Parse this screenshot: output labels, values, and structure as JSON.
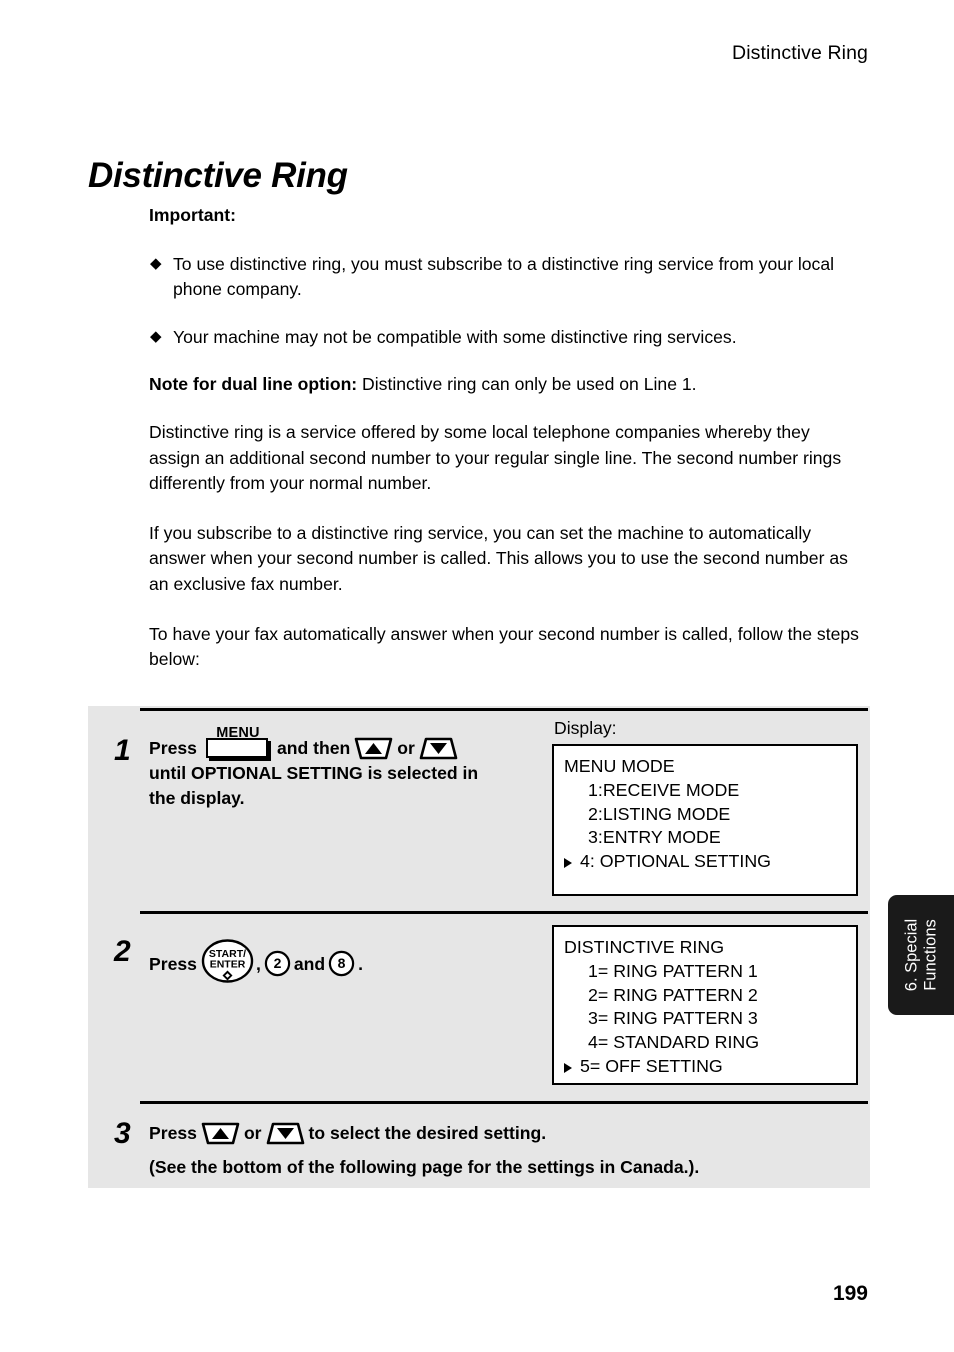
{
  "running_head": "Distinctive Ring",
  "page_title": "Distinctive Ring",
  "folio": "199",
  "prose": {
    "important_label": "Important:",
    "bullets": [
      "To use distinctive ring, you must subscribe to a distinctive ring service from your local phone company.",
      "Your machine may not be compatible with some distinctive ring services."
    ],
    "note_label": "Note for dual line option:",
    "note_text": " Distinctive ring can only be used on Line 1.",
    "paragraphs": [
      "Distinctive ring is a service offered by some local telephone companies whereby they assign an additional second number to your regular single line. The second number rings differently from your normal number.",
      "If you subscribe to a distinctive ring service, you can set the machine to automatically answer when your second number is called. This allows you to use the second number as an exclusive fax number.",
      "To have your fax automatically answer when your second number is called, follow the steps below:"
    ]
  },
  "steps": {
    "display_label": "Display:",
    "step1": {
      "number": "1",
      "text_press": "Press",
      "text_and_then": "and then",
      "text_or": "or",
      "line2": "until OPTIONAL SETTING is selected in",
      "line3": "the display.",
      "key_menu_caption": "MENU",
      "display_lines": [
        {
          "text": "MENU MODE",
          "indent": false,
          "cursor": false
        },
        {
          "text": "1:RECEIVE MODE",
          "indent": true,
          "cursor": false
        },
        {
          "text": "2:LISTING MODE",
          "indent": true,
          "cursor": false
        },
        {
          "text": "3:ENTRY MODE",
          "indent": true,
          "cursor": false
        },
        {
          "text": "4: OPTIONAL SETTING",
          "indent": false,
          "cursor": true
        }
      ]
    },
    "step2": {
      "number": "2",
      "text_press": "Press",
      "text_comma": ",",
      "text_and": "and",
      "text_period": ".",
      "key_start_line1": "START/",
      "key_start_line2": "ENTER",
      "key_num_first": "2",
      "key_num_second": "8",
      "display_lines": [
        {
          "text": "DISTINCTIVE RING",
          "indent": false,
          "cursor": false
        },
        {
          "text": "1= RING PATTERN 1",
          "indent": true,
          "cursor": false
        },
        {
          "text": "2= RING PATTERN 2",
          "indent": true,
          "cursor": false
        },
        {
          "text": "3= RING PATTERN 3",
          "indent": true,
          "cursor": false
        },
        {
          "text": "4= STANDARD RING",
          "indent": true,
          "cursor": false
        },
        {
          "text": "5= OFF SETTING",
          "indent": false,
          "cursor": true
        }
      ]
    },
    "step3": {
      "number": "3",
      "text_press": "Press",
      "text_or": "or",
      "text_tail": "to select the desired setting.",
      "line2": "(See the bottom of the following page for the settings in Canada.)."
    }
  },
  "thumb_tab": {
    "line1": "6. Special",
    "line2": "Functions"
  },
  "colors": {
    "panel_background": "#e6e6e6",
    "rule": "#000000",
    "tab_background": "#1a1a1a",
    "tab_text": "#ffffff",
    "page_background": "#ffffff"
  },
  "icons": {
    "bullet": "◆",
    "cursor": "▶",
    "arrow_up": "▲",
    "arrow_down": "▼",
    "start_diamond": "◇"
  }
}
